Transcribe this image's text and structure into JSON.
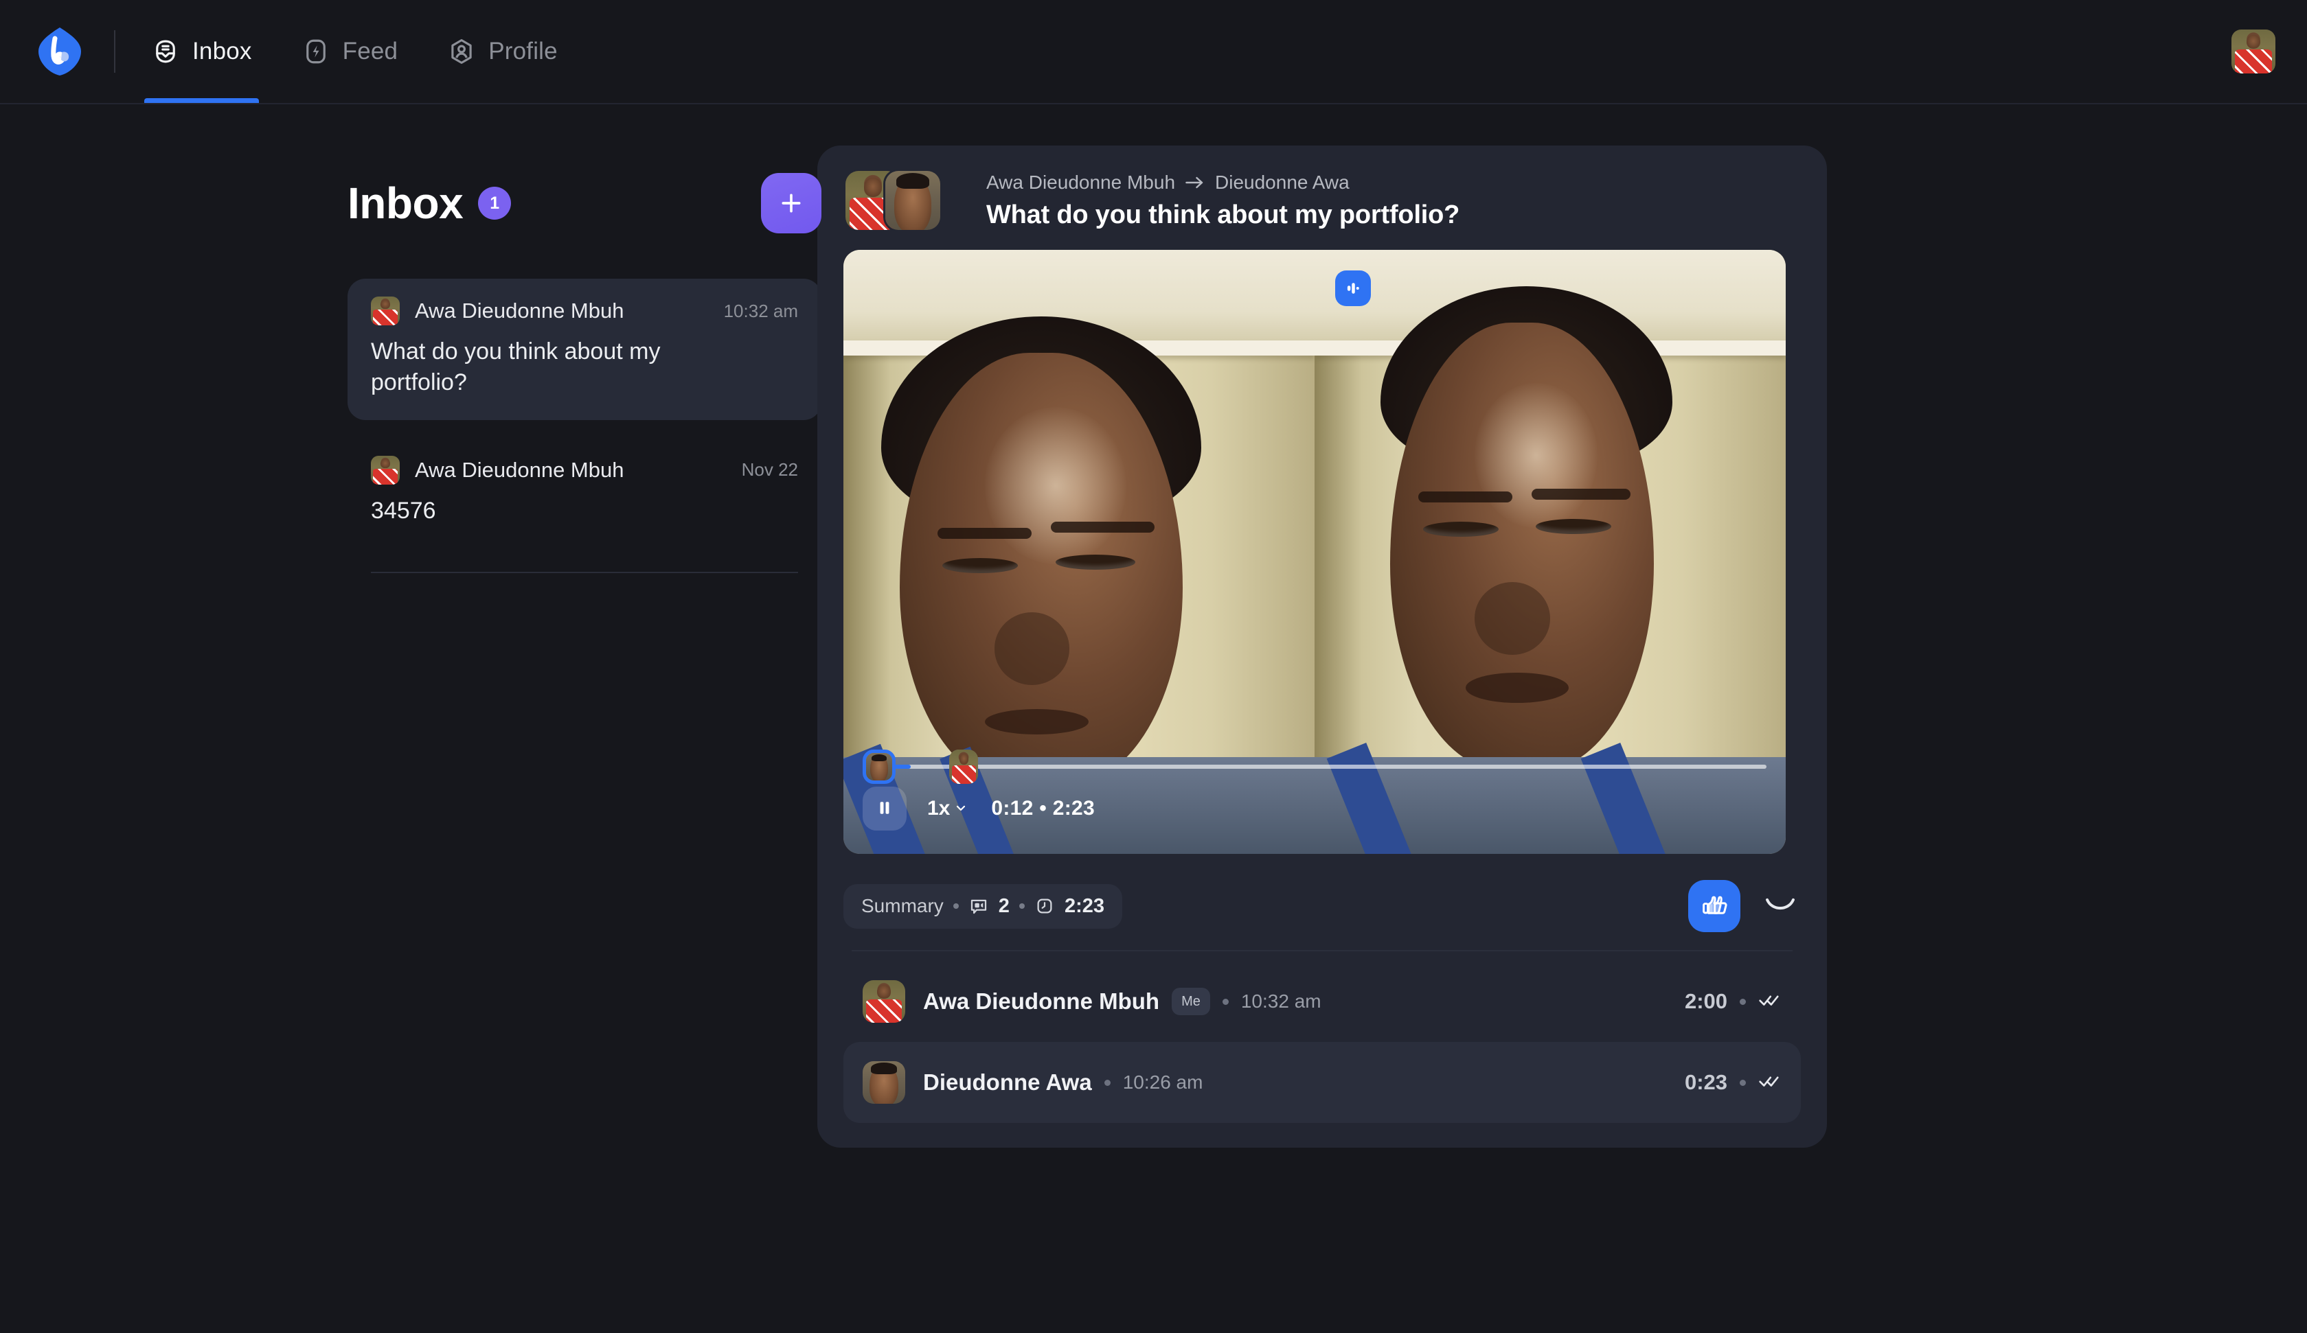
{
  "brand": {
    "logo_icon": "app-logo-icon",
    "accent_blue": "#2f73f3",
    "accent_purple": "#7b62f0",
    "page_bg": "#16171c",
    "card_bg": "#232632"
  },
  "nav": {
    "items": [
      {
        "label": "Inbox",
        "icon": "inbox-icon",
        "active": true
      },
      {
        "label": "Feed",
        "icon": "lightning-icon",
        "active": false
      },
      {
        "label": "Profile",
        "icon": "person-hexagon-icon",
        "active": false
      }
    ],
    "account_avatar_alt": "Awa Dieudonne Mbuh"
  },
  "sidebar": {
    "title": "Inbox",
    "unread_badge": "1",
    "compose_label": "+",
    "threads": [
      {
        "name": "Awa Dieudonne Mbuh",
        "time": "10:32 am",
        "preview": "What do you think about my portfolio?",
        "selected": true
      },
      {
        "name": "Awa Dieudonne Mbuh",
        "time": "Nov 22",
        "preview": "34576",
        "selected": false
      }
    ]
  },
  "conversation": {
    "participant_from": "Awa Dieudonne Mbuh",
    "participant_to": "Dieudonne Awa",
    "title": "What do you think about my portfolio?",
    "player": {
      "wave_badge_icon": "audio-waveform-icon",
      "play_state_icon": "pause-icon",
      "speed": "1x",
      "current_time": "0:12",
      "separator": "•",
      "duration": "2:23",
      "progress_percent": 5.3,
      "marker_percent": 9.6
    },
    "summary": {
      "label": "Summary",
      "messages_icon": "video-message-icon",
      "messages_count": "2",
      "duration_icon": "clock-icon",
      "duration": "2:23"
    },
    "reactions": {
      "thumbs_up_icon": "thumbs-up-icon",
      "add_reaction_icon": "smile-icon"
    },
    "messages": [
      {
        "name": "Awa Dieudonne Mbuh",
        "me_badge": "Me",
        "time": "10:32 am",
        "duration": "2:00",
        "status_icon": "double-check-icon",
        "highlight": false
      },
      {
        "name": "Dieudonne Awa",
        "me_badge": "",
        "time": "10:26 am",
        "duration": "0:23",
        "status_icon": "double-check-icon",
        "highlight": true
      }
    ]
  }
}
